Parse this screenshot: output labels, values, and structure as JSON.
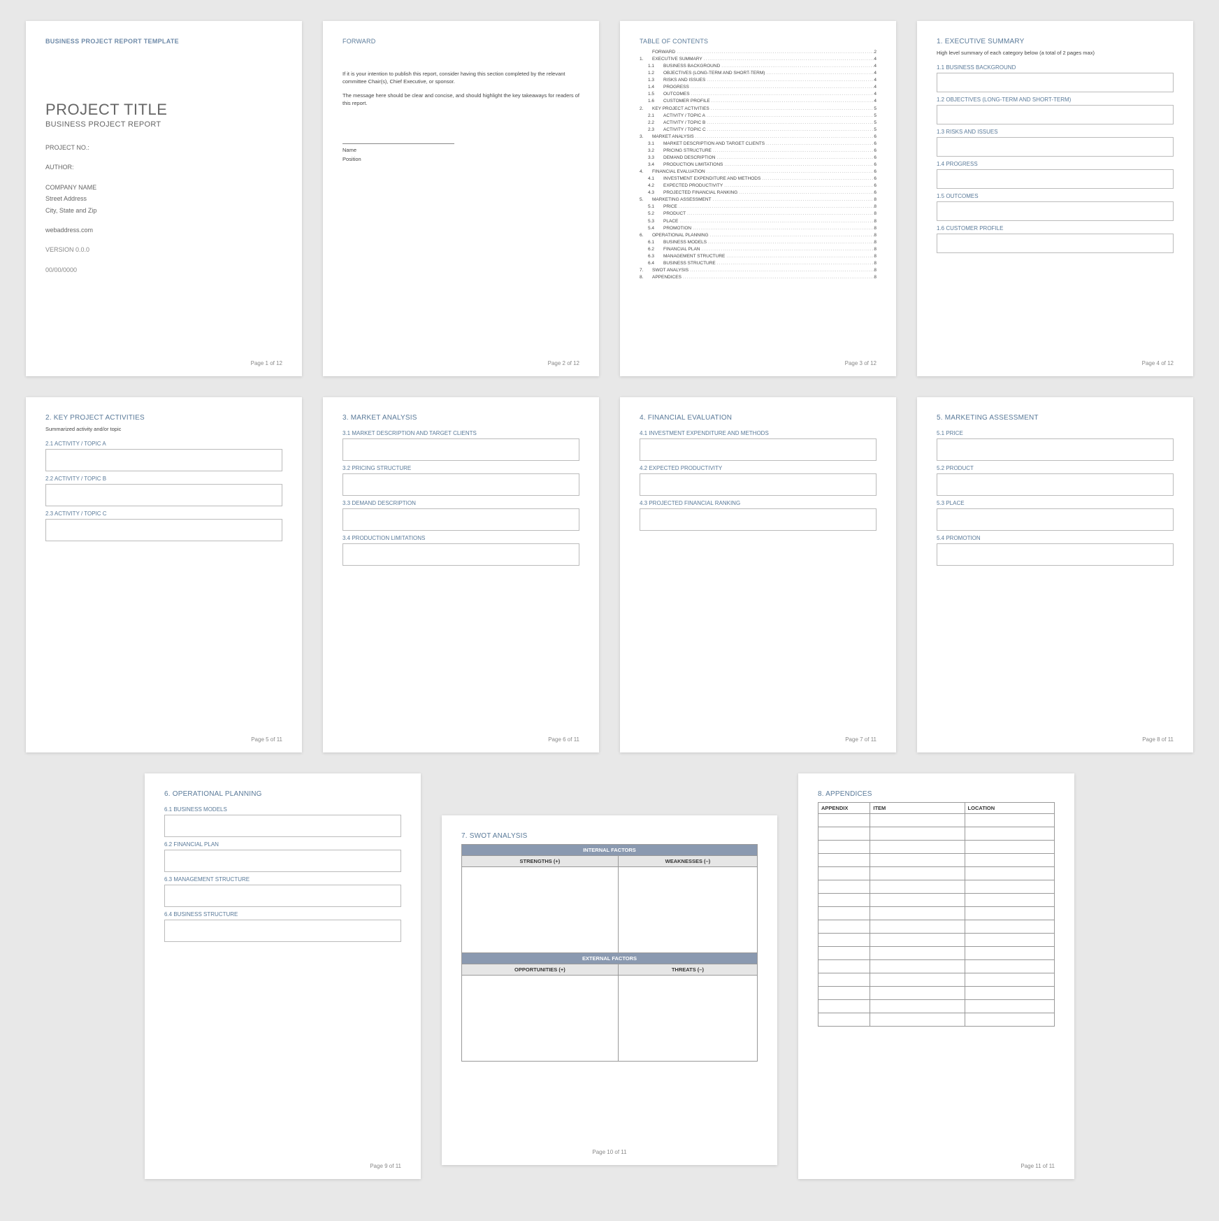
{
  "doc": {
    "template_header": "BUSINESS PROJECT REPORT TEMPLATE",
    "title": "PROJECT TITLE",
    "subtitle": "BUSINESS PROJECT REPORT",
    "project_no": "PROJECT NO.:",
    "author": "AUTHOR:",
    "company": "COMPANY NAME",
    "street": "Street Address",
    "citystate": "City, State and Zip",
    "web": "webaddress.com",
    "version": "VERSION 0.0.0",
    "date": "00/00/0000"
  },
  "forward": {
    "heading": "FORWARD",
    "p1": "If it is your intention to publish this report, consider having this section completed by the relevant committee Chair(s), Chief Executive, or sponsor.",
    "p2": "The message here should be clear and concise, and should highlight the key takeaways for readers of this report.",
    "name": "Name",
    "position": "Position"
  },
  "toc": {
    "heading": "TABLE OF CONTENTS",
    "rows": [
      {
        "n": "",
        "l": "FORWARD",
        "p": "2",
        "sub": false
      },
      {
        "n": "1.",
        "l": "EXECUTIVE SUMMARY",
        "p": "4",
        "sub": false
      },
      {
        "n": "1.1",
        "l": "BUSINESS BACKGROUND",
        "p": "4",
        "sub": true
      },
      {
        "n": "1.2",
        "l": "OBJECTIVES (LONG-TERM AND SHORT-TERM)",
        "p": "4",
        "sub": true
      },
      {
        "n": "1.3",
        "l": "RISKS AND ISSUES",
        "p": "4",
        "sub": true
      },
      {
        "n": "1.4",
        "l": "PROGRESS",
        "p": "4",
        "sub": true
      },
      {
        "n": "1.5",
        "l": "OUTCOMES",
        "p": "4",
        "sub": true
      },
      {
        "n": "1.6",
        "l": "CUSTOMER PROFILE",
        "p": "4",
        "sub": true
      },
      {
        "n": "2.",
        "l": "KEY PROJECT ACTIVITIES",
        "p": "5",
        "sub": false
      },
      {
        "n": "2.1",
        "l": "ACTIVITY / TOPIC A",
        "p": "5",
        "sub": true
      },
      {
        "n": "2.2",
        "l": "ACTIVITY / TOPIC B",
        "p": "5",
        "sub": true
      },
      {
        "n": "2.3",
        "l": "ACTIVITY / TOPIC C",
        "p": "5",
        "sub": true
      },
      {
        "n": "3.",
        "l": "MARKET ANALYSIS",
        "p": "6",
        "sub": false
      },
      {
        "n": "3.1",
        "l": "MARKET DESCRIPTION AND TARGET CLIENTS",
        "p": "6",
        "sub": true
      },
      {
        "n": "3.2",
        "l": "PRICING STRUCTURE",
        "p": "6",
        "sub": true
      },
      {
        "n": "3.3",
        "l": "DEMAND DESCRIPTION",
        "p": "6",
        "sub": true
      },
      {
        "n": "3.4",
        "l": "PRODUCTION LIMITATIONS",
        "p": "6",
        "sub": true
      },
      {
        "n": "4.",
        "l": "FINANCIAL EVALUATION",
        "p": "6",
        "sub": false
      },
      {
        "n": "4.1",
        "l": "INVESTMENT EXPENDITURE AND METHODS",
        "p": "6",
        "sub": true
      },
      {
        "n": "4.2",
        "l": "EXPECTED PRODUCTIVITY",
        "p": "6",
        "sub": true
      },
      {
        "n": "4.3",
        "l": "PROJECTED FINANCIAL RANKING",
        "p": "6",
        "sub": true
      },
      {
        "n": "5.",
        "l": "MARKETING ASSESSMENT",
        "p": "8",
        "sub": false
      },
      {
        "n": "5.1",
        "l": "PRICE",
        "p": "8",
        "sub": true
      },
      {
        "n": "5.2",
        "l": "PRODUCT",
        "p": "8",
        "sub": true
      },
      {
        "n": "5.3",
        "l": "PLACE",
        "p": "8",
        "sub": true
      },
      {
        "n": "5.4",
        "l": "PROMOTION",
        "p": "8",
        "sub": true
      },
      {
        "n": "6.",
        "l": "OPERATIONAL PLANNING",
        "p": "8",
        "sub": false
      },
      {
        "n": "6.1",
        "l": "BUSINESS MODELS",
        "p": "8",
        "sub": true
      },
      {
        "n": "6.2",
        "l": "FINANCIAL PLAN",
        "p": "8",
        "sub": true
      },
      {
        "n": "6.3",
        "l": "MANAGEMENT STRUCTURE",
        "p": "8",
        "sub": true
      },
      {
        "n": "6.4",
        "l": "BUSINESS STRUCTURE",
        "p": "8",
        "sub": true
      },
      {
        "n": "7.",
        "l": "SWOT ANALYSIS",
        "p": "8",
        "sub": false
      },
      {
        "n": "8.",
        "l": "APPENDICES",
        "p": "8",
        "sub": false
      }
    ]
  },
  "p4": {
    "h": "1. EXECUTIVE SUMMARY",
    "note": "High level summary of each category below (a total of 2 pages max)",
    "s": [
      "1.1  BUSINESS BACKGROUND",
      "1.2  OBJECTIVES (LONG-TERM AND SHORT-TERM)",
      "1.3  RISKS AND ISSUES",
      "1.4  PROGRESS",
      "1.5  OUTCOMES",
      "1.6  CUSTOMER PROFILE"
    ]
  },
  "p5": {
    "h": "2. KEY PROJECT ACTIVITIES",
    "note": "Summarized activity and/or topic",
    "s": [
      "2.1  ACTIVITY / TOPIC A",
      "2.2  ACTIVITY / TOPIC B",
      "2.3  ACTIVITY / TOPIC C"
    ]
  },
  "p6": {
    "h": "3. MARKET ANALYSIS",
    "s": [
      "3.1  MARKET DESCRIPTION AND TARGET CLIENTS",
      "3.2  PRICING STRUCTURE",
      "3.3  DEMAND DESCRIPTION",
      "3.4  PRODUCTION LIMITATIONS"
    ]
  },
  "p7": {
    "h": "4. FINANCIAL EVALUATION",
    "s": [
      "4.1  INVESTMENT EXPENDITURE AND METHODS",
      "4.2  EXPECTED PRODUCTIVITY",
      "4.3  PROJECTED FINANCIAL RANKING"
    ]
  },
  "p8": {
    "h": "5. MARKETING ASSESSMENT",
    "s": [
      "5.1  PRICE",
      "5.2  PRODUCT",
      "5.3  PLACE",
      "5.4  PROMOTION"
    ]
  },
  "p9": {
    "h": "6. OPERATIONAL PLANNING",
    "s": [
      "6.1  BUSINESS MODELS",
      "6.2  FINANCIAL PLAN",
      "6.3  MANAGEMENT STRUCTURE",
      "6.4  BUSINESS STRUCTURE"
    ]
  },
  "p10": {
    "h": "7. SWOT ANALYSIS",
    "internal": "INTERNAL FACTORS",
    "external": "EXTERNAL FACTORS",
    "strengths": "STRENGTHS (+)",
    "weaknesses": "WEAKNESSES (–)",
    "opportunities": "OPPORTUNITIES (+)",
    "threats": "THREATS (–)"
  },
  "p11": {
    "h": "8. APPENDICES",
    "cols": [
      "APPENDIX",
      "ITEM",
      "LOCATION"
    ],
    "rowcount": 16
  },
  "pagenums": {
    "1": "Page 1 of 12",
    "2": "Page 2 of 12",
    "3": "Page 3 of 12",
    "4": "Page 4 of 12",
    "5": "Page 5 of 11",
    "6": "Page 6 of 11",
    "7": "Page 7 of 11",
    "8": "Page 8 of 11",
    "9": "Page 9 of 11",
    "10": "Page 10 of 11",
    "11": "Page 11 of 11"
  }
}
